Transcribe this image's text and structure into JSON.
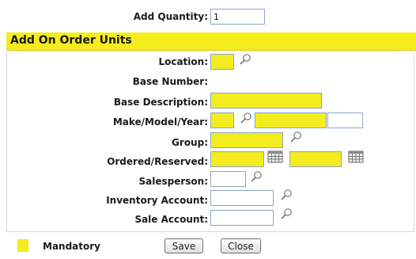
{
  "add_quantity": {
    "label": "Add Quantity:",
    "value": "1"
  },
  "section": {
    "title": "Add On Order Units"
  },
  "fields": {
    "location": {
      "label": "Location:",
      "value": ""
    },
    "base_number": {
      "label": "Base Number:"
    },
    "base_description": {
      "label": "Base Description:",
      "value": ""
    },
    "make_model_year": {
      "label": "Make/Model/Year:",
      "make": "",
      "model": "",
      "year": ""
    },
    "group": {
      "label": "Group:",
      "value": ""
    },
    "ordered_reserved": {
      "label": "Ordered/Reserved:",
      "ordered": "",
      "reserved": ""
    },
    "salesperson": {
      "label": "Salesperson:",
      "value": ""
    },
    "inventory_account": {
      "label": "Inventory Account:",
      "value": ""
    },
    "sale_account": {
      "label": "Sale Account:",
      "value": ""
    }
  },
  "legend": {
    "label": "Mandatory",
    "color": "#f3ec1f"
  },
  "buttons": {
    "save": "Save",
    "close": "Close"
  },
  "icons": {
    "lookup": "magnifier-icon",
    "calendar": "calendar-icon"
  }
}
